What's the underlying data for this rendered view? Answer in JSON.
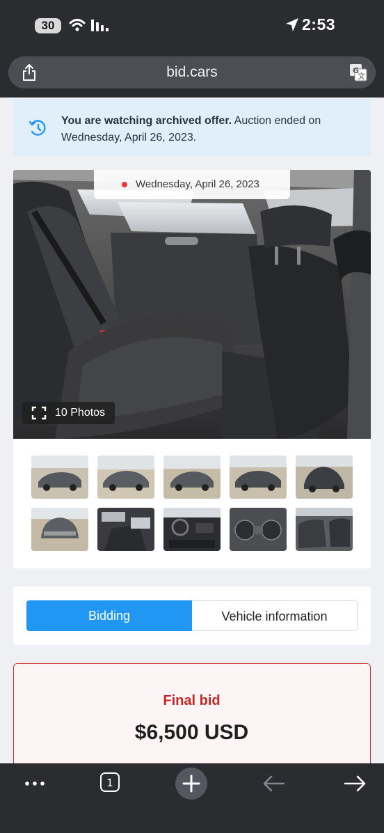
{
  "status_bar": {
    "battery": "30",
    "time": "2:53"
  },
  "browser": {
    "url": "bid.cars"
  },
  "notice": {
    "bold_text": "You are watching archived offer.",
    "text": " Auction ended on Wednesday, April 26, 2023."
  },
  "gallery": {
    "date_badge": "Wednesday, April 26, 2023",
    "photos_button": "10 Photos"
  },
  "tabs": {
    "bidding": "Bidding",
    "vehicle_info": "Vehicle information"
  },
  "bid": {
    "label": "Final bid",
    "amount": "$6,500 USD"
  }
}
